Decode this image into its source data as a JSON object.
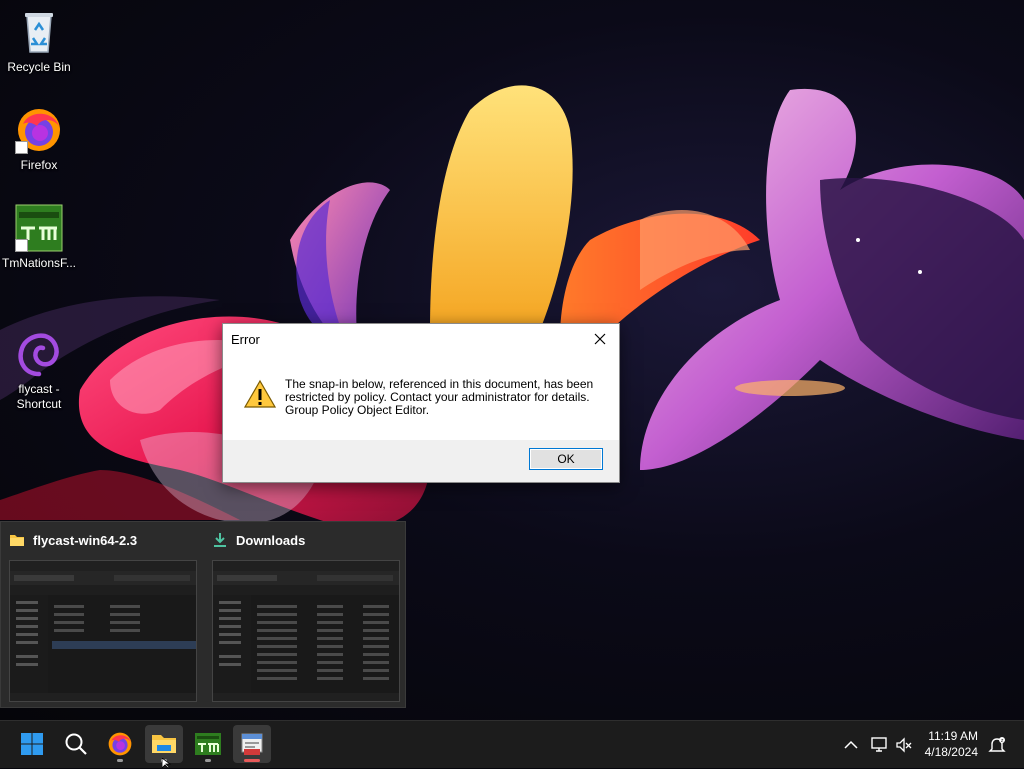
{
  "desktop": {
    "icons": [
      {
        "label": "Recycle Bin"
      },
      {
        "label": "Firefox"
      },
      {
        "label": "TmNationsF..."
      },
      {
        "label": "flycast -\nShortcut"
      }
    ]
  },
  "dialog": {
    "title": "Error",
    "message": "The snap-in below, referenced in this document, has been\nrestricted by policy. Contact your administrator for details.\nGroup Policy Object Editor.",
    "ok_label": "OK"
  },
  "preview": {
    "windows": [
      {
        "title": "flycast-win64-2.3"
      },
      {
        "title": "Downloads"
      }
    ]
  },
  "taskbar": {
    "time": "11:19 AM",
    "date": "4/18/2024",
    "accent": "#0078d4"
  }
}
